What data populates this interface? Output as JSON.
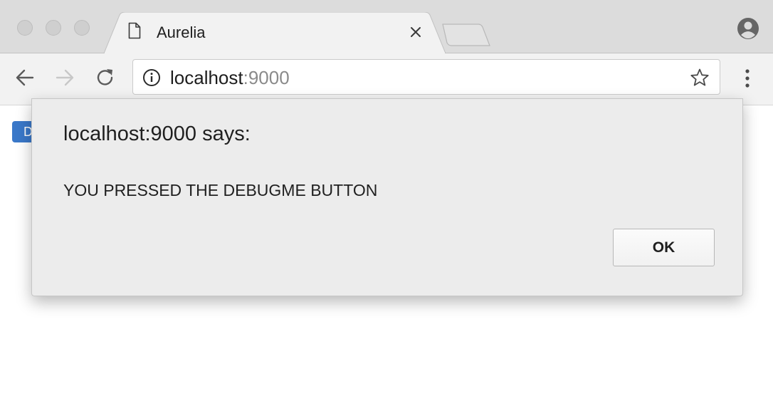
{
  "browser": {
    "tab": {
      "title": "Aurelia",
      "page_icon": "page-icon",
      "close_icon": "close-icon"
    },
    "toolbar": {
      "back_icon": "back-arrow-icon",
      "forward_icon": "forward-arrow-icon",
      "reload_icon": "reload-icon",
      "url_host": "localhost",
      "url_port": ":9000",
      "info_icon": "info-icon",
      "bookmark_icon": "star-icon",
      "menu_icon": "kebab-menu-icon"
    },
    "profile_icon": "profile-icon"
  },
  "page": {
    "button_label": "D",
    "button_color": "#3a78c9"
  },
  "alert": {
    "title": "localhost:9000 says:",
    "message": "YOU PRESSED THE DEBUGME BUTTON",
    "ok_label": "OK"
  },
  "colors": {
    "titlebar": "#dcdcdc",
    "toolbar": "#f2f2f2",
    "dialog": "#ececec"
  }
}
